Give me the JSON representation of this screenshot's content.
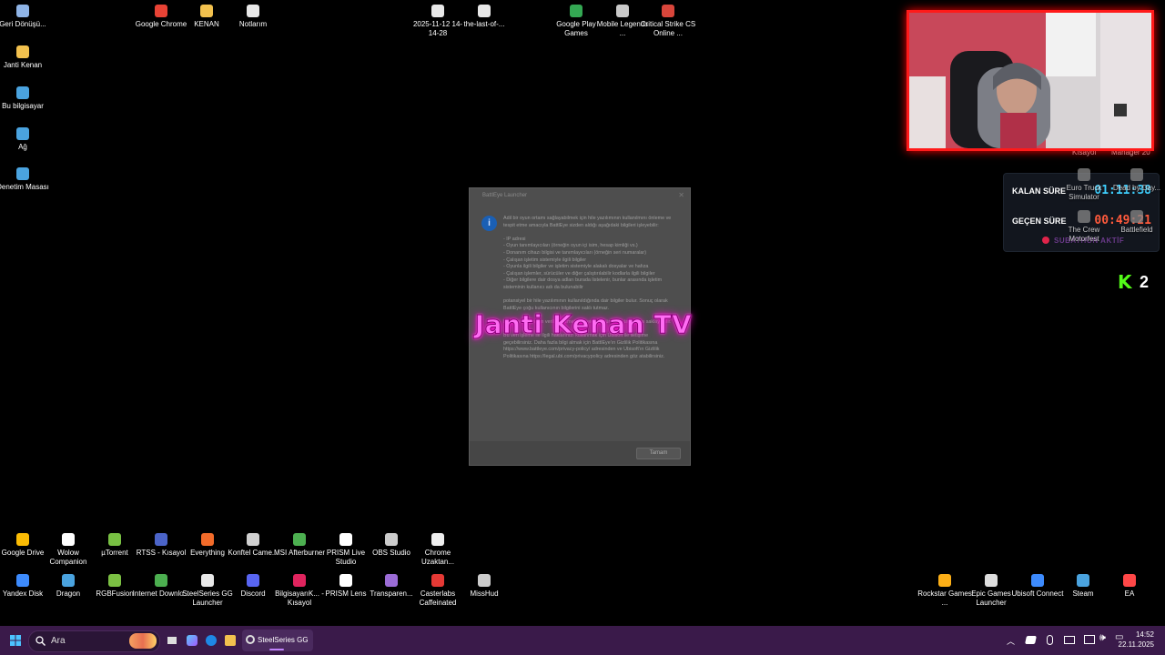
{
  "desktop_icons_top": [
    {
      "label": "Geri Dönüşü...",
      "icon": "recycle-bin-icon",
      "color": "#8fb4e6"
    },
    {
      "label": "Google Chrome",
      "icon": "chrome-icon",
      "color": "#e84335"
    },
    {
      "label": "KENAN",
      "icon": "folder-icon",
      "color": "#f2c14e"
    },
    {
      "label": "Notlarım",
      "icon": "notes-icon",
      "color": "#e8e8e8"
    },
    {
      "label": "2025-11-12 14-14-28",
      "icon": "video-file-icon",
      "color": "#e8e8e8"
    },
    {
      "label": "the-last-of-...",
      "icon": "document-icon",
      "color": "#e8e8e8"
    },
    {
      "label": "Google Play Games",
      "icon": "google-play-games-icon",
      "color": "#34a853"
    },
    {
      "label": "Mobile Legends ...",
      "icon": "mobile-legends-icon",
      "color": "#c9c9c9"
    },
    {
      "label": "Critical Strike CS Online ...",
      "icon": "critical-strike-icon",
      "color": "#d9463b"
    }
  ],
  "desktop_icons_left": [
    {
      "label": "Janti Kenan",
      "icon": "folder-icon",
      "color": "#f2c14e"
    },
    {
      "label": "Bu bilgisayar",
      "icon": "computer-icon",
      "color": "#4aa3df"
    },
    {
      "label": "Ağ",
      "icon": "network-icon",
      "color": "#4aa3df"
    },
    {
      "label": "Denetim Masası",
      "icon": "control-panel-icon",
      "color": "#4aa3df"
    }
  ],
  "desktop_icons_row1": [
    {
      "label": "Google Drive",
      "icon": "google-drive-icon",
      "color": "#fbbc04"
    },
    {
      "label": "Wolow Companion",
      "icon": "wolow-icon",
      "color": "#ffffff"
    },
    {
      "label": "µTorrent",
      "icon": "utorrent-icon",
      "color": "#78c043"
    },
    {
      "label": "RTSS - Kısayol",
      "icon": "rtss-icon",
      "color": "#4b64c8"
    },
    {
      "label": "Everything",
      "icon": "search-everything-icon",
      "color": "#f26b2a"
    },
    {
      "label": "Konftel Came...",
      "icon": "konftel-icon",
      "color": "#d0d0d0"
    },
    {
      "label": "MSI Afterburner",
      "icon": "msi-afterburner-icon",
      "color": "#4caf50"
    },
    {
      "label": "PRISM Live Studio",
      "icon": "prism-icon",
      "color": "#ffffff"
    },
    {
      "label": "OBS Studio",
      "icon": "obs-icon",
      "color": "#cccccc"
    },
    {
      "label": "Chrome Uzaktan...",
      "icon": "chrome-remote-icon",
      "color": "#eeeeee"
    }
  ],
  "desktop_icons_row2": [
    {
      "label": "Yandex Disk",
      "icon": "yandex-disk-icon",
      "color": "#3d8bfd"
    },
    {
      "label": "Dragon",
      "icon": "dragon-icon",
      "color": "#4aa3df"
    },
    {
      "label": "RGBFusion",
      "icon": "rgb-fusion-icon",
      "color": "#7bc043"
    },
    {
      "label": "Internet Downlo...",
      "icon": "idm-icon",
      "color": "#4caf50"
    },
    {
      "label": "SteelSeries GG Launcher",
      "icon": "steelseries-icon",
      "color": "#e8e8e8"
    },
    {
      "label": "Discord",
      "icon": "discord-icon",
      "color": "#5865f2"
    },
    {
      "label": "BilgisayarıK... - Kısayol",
      "icon": "shortcut-icon",
      "color": "#e0245e"
    },
    {
      "label": "PRISM Lens",
      "icon": "prism-lens-icon",
      "color": "#ffffff"
    },
    {
      "label": "Transparen...",
      "icon": "transparent-icon",
      "color": "#9b6cd6"
    },
    {
      "label": "Casterlabs Caffeinated",
      "icon": "casterlabs-icon",
      "color": "#e53935"
    },
    {
      "label": "MissHud",
      "icon": "misshud-icon",
      "color": "#cccccc"
    }
  ],
  "desktop_icons_right": [
    {
      "label": "Rockstar Games ...",
      "icon": "rockstar-icon",
      "color": "#fcaf17"
    },
    {
      "label": "Epic Games Launcher",
      "icon": "epic-games-icon",
      "color": "#dddddd"
    },
    {
      "label": "Ubisoft Connect",
      "icon": "ubisoft-icon",
      "color": "#3d8bfd"
    },
    {
      "label": "Steam",
      "icon": "steam-icon",
      "color": "#4aa3df"
    },
    {
      "label": "EA",
      "icon": "ea-icon",
      "color": "#ff4747"
    }
  ],
  "behind_webcam": {
    "kisayol": "Kısayol",
    "manager": "Manager 20"
  },
  "timer_panel": {
    "remaining_label": "KALAN SÜRE",
    "remaining_value": "01:11:38",
    "elapsed_label": "GEÇEN SÜRE",
    "elapsed_value": "00:49:21",
    "status": "SUBATHON AKTİF",
    "remaining_color": "#3fd0ff",
    "elapsed_color": "#ff5a3c"
  },
  "timer_ghost_icons": [
    {
      "label": "Euro Truck Simulator",
      "icon": "euro-truck-icon"
    },
    {
      "label": "Dead by Day...",
      "icon": "dead-by-daylight-icon"
    },
    {
      "label": "The Crew Motorfest",
      "icon": "the-crew-icon"
    },
    {
      "label": "Battlefield",
      "icon": "battlefield-icon"
    }
  ],
  "kick_badge": {
    "letter": "K",
    "count": "2",
    "color": "#53fc18"
  },
  "dialog": {
    "title": "BattlEye Launcher",
    "body": "Adil bir oyun ortamı sağlayabilmek için hile yazılımının kullanılmını önleme ve tespit etme amacıyla BattlEye sizden aldığı aşağıdaki bilgileri işleyebilir:\n\n- IP adresi\n- Oyun tanımlayıcıları (örneğin oyun içi isim, hesap kimliği vs.)\n- Donanım cihazı bilgisi ve tanımlayıcıları (örneğin seri numaralar)\n- Çalışan işletim sistemiyle ilgili bilgiler\n- Oyunla ilgili bilgiler ve işletim sistemiyle alakalı dosyalar ve hafıza\n- Çalışan işlemler, sürücüler ve diğer çalıştırılabilir kodlarla ilgili bilgiler\n- Diğer bilgilere dair dosya adları burada listelenir, bunlar arasında işletim sisteminin kullanıcı adı da bulunabilir\n\npotansiyel bir hile yazılımının kullanıldığında dair bilgiler bulur. Sonuç olarak BattlEye çoğu kullanıcının bilgilerini saklı tutmaz.\n\nBattlEye, oyun için verilen hizmetlerin verilme süresinin tamamını saklayabilir.\n\nBu veri işleme ile ilgili haklarınızı kullanmak için Ubisoft ile iletişime geçebilirsiniz. Daha fazla bilgi almak için BattlEye'ın Gizlilik Politikasına https://www.battleye.com/privacy-policy/ adresinden ve Ubisoft'ın Gizlilik Politikasına https://legal.ubi.com/privacypolicy adresinden göz atabilirsiniz.",
    "ok_label": "Tamam"
  },
  "overlay_title": "Janti Kenan TV",
  "taskbar": {
    "search_placeholder": "Ara",
    "active_app": "SteelSeries GG",
    "time": "14:52",
    "date": "22.11.2025",
    "bg_color": "#3a1a4a"
  }
}
